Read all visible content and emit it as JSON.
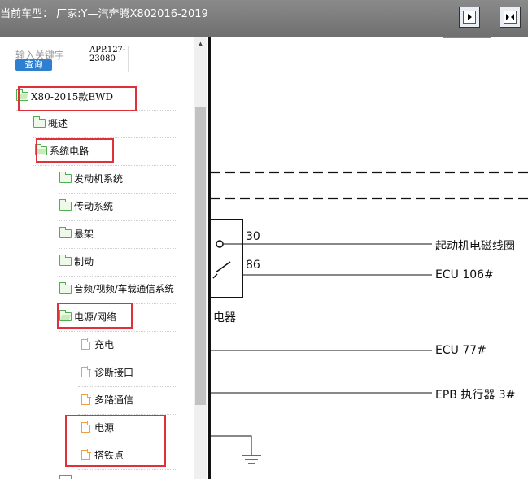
{
  "header": {
    "title": "当前车型：  厂家:Y—汽奔腾X802016-2019",
    "buttons": [
      {
        "name": "single-view-button",
        "icon": "arrow-right-icon"
      },
      {
        "name": "split-view-button",
        "icon": "arrows-inward-icon"
      }
    ]
  },
  "search": {
    "placeholder": "输入关键字",
    "query_label": "查询",
    "app_label": "APP.127-23080"
  },
  "tree": {
    "root": {
      "label": "X80-2015款EWD",
      "type": "folder-open"
    },
    "items": [
      {
        "label": "概述",
        "type": "folder"
      },
      {
        "label": "系统电路",
        "type": "folder-open"
      },
      {
        "label": "发动机系统",
        "type": "folder"
      },
      {
        "label": "传动系统",
        "type": "folder"
      },
      {
        "label": "悬架",
        "type": "folder"
      },
      {
        "label": "制动",
        "type": "folder"
      },
      {
        "label": "音频/视频/车载通信系统",
        "type": "folder"
      },
      {
        "label": "电源/网络",
        "type": "folder-open"
      },
      {
        "label": "充电",
        "type": "doc"
      },
      {
        "label": "诊断接口",
        "type": "doc"
      },
      {
        "label": "多路通信",
        "type": "doc"
      },
      {
        "label": "电源",
        "type": "doc"
      },
      {
        "label": "搭铁点",
        "type": "doc"
      }
    ]
  },
  "diagram": {
    "pin_30": "30",
    "pin_86": "86",
    "line_labels": [
      "起动机电磁线圈",
      "ECU 106#",
      "ECU 77#",
      "EPB 执行器 3#"
    ],
    "relay_label": "电器"
  },
  "colors": {
    "highlight_box": "#e0303a",
    "folder": "#4caf50",
    "doc": "#f0a040",
    "query_button": "#2f7fd0",
    "topbar": "#7a7a7a"
  }
}
